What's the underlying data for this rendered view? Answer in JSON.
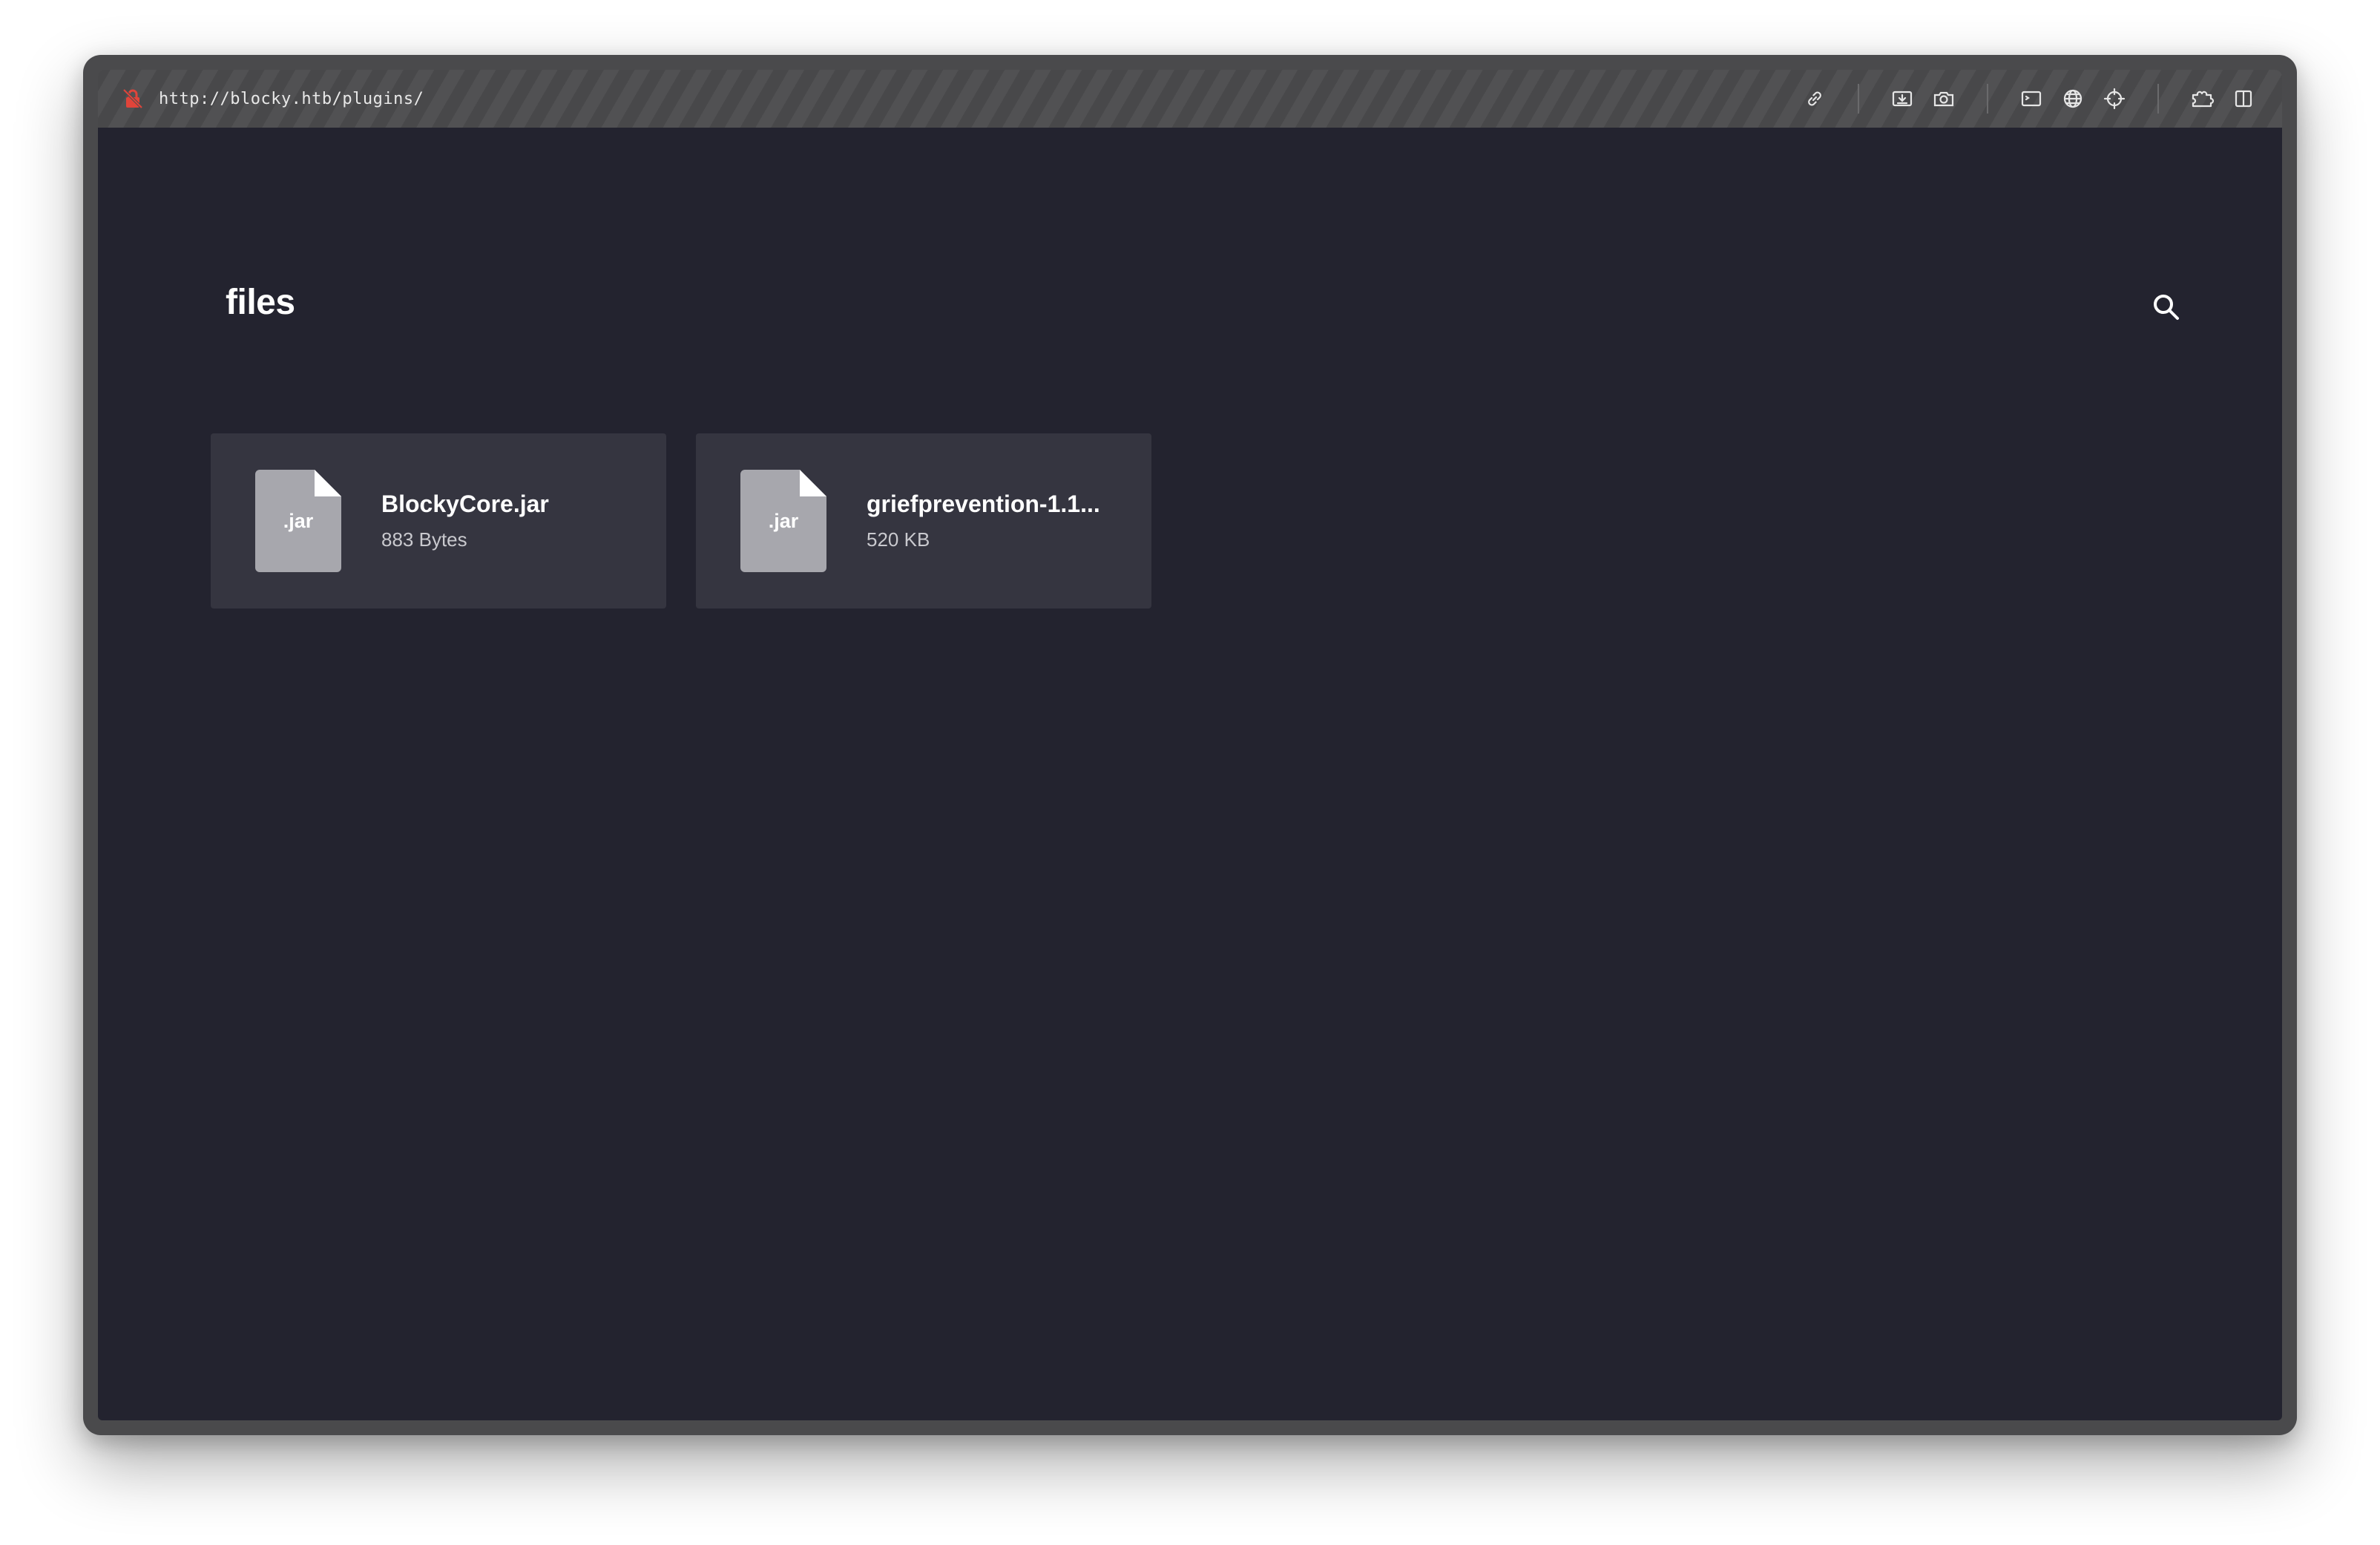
{
  "browser": {
    "url": "http://blocky.htb/plugins/",
    "lock_icon": "insecure-lock-icon",
    "accent_color": "#e0443a",
    "tools": [
      {
        "name": "copy-link-icon",
        "group": 1
      },
      {
        "name": "download-icon",
        "group": 2
      },
      {
        "name": "camera-icon",
        "group": 2
      },
      {
        "name": "terminal-icon",
        "group": 3
      },
      {
        "name": "globe-icon",
        "group": 3
      },
      {
        "name": "crosshair-icon",
        "group": 3
      },
      {
        "name": "extension-icon",
        "group": 4
      },
      {
        "name": "split-view-icon",
        "group": 4
      }
    ]
  },
  "page": {
    "title": "files",
    "background": "#23232f",
    "search_icon": "search-icon"
  },
  "files": [
    {
      "ext": ".jar",
      "name": "BlockyCore.jar",
      "size": "883 Bytes"
    },
    {
      "ext": ".jar",
      "name": "griefprevention-1.1...",
      "size": "520 KB"
    }
  ]
}
